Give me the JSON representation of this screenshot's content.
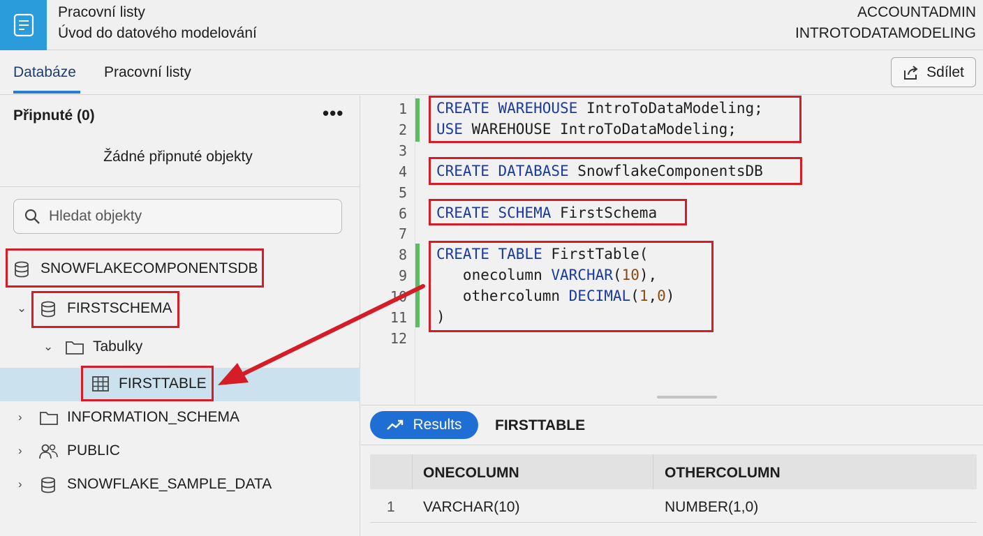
{
  "header": {
    "title_line1": "Pracovní listy",
    "title_line2": "Úvod do datového modelování",
    "role": "ACCOUNTADMIN",
    "warehouse": "INTROTODATAMODELING"
  },
  "tabs": [
    {
      "label": "Databáze",
      "active": true
    },
    {
      "label": "Pracovní listy",
      "active": false
    }
  ],
  "share_label": "Sdílet",
  "sidebar": {
    "pinned_header": "Připnuté (0)",
    "pinned_empty": "Žádné připnuté objekty",
    "search_placeholder": "Hledat objekty",
    "tree": [
      {
        "label": "SNOWFLAKECOMPONENTSDB",
        "icon": "database-icon",
        "level": 0,
        "highlighted": true
      },
      {
        "label": "FIRSTSCHEMA",
        "icon": "schema-icon",
        "level": 1,
        "expanded": true,
        "highlighted": true
      },
      {
        "label": "Tabulky",
        "icon": "folder-icon",
        "level": 2,
        "expanded": true
      },
      {
        "label": "FIRSTTABLE",
        "icon": "table-icon",
        "level": 3,
        "selected": true,
        "highlighted": true
      },
      {
        "label": "INFORMATION_SCHEMA",
        "icon": "folder-icon",
        "level": 1,
        "expanded": false
      },
      {
        "label": "PUBLIC",
        "icon": "users-icon",
        "level": 1,
        "expanded": false
      },
      {
        "label": "SNOWFLAKE_SAMPLE_DATA",
        "icon": "database-icon",
        "level": 1,
        "expanded": false
      }
    ]
  },
  "editor": {
    "line_numbers": [
      "1",
      "2",
      "3",
      "4",
      "5",
      "6",
      "7",
      "8",
      "9",
      "10",
      "11",
      "12"
    ],
    "lines": [
      "CREATE WAREHOUSE IntroToDataModeling;",
      "USE WAREHOUSE IntroToDataModeling;",
      "",
      "CREATE DATABASE SnowflakeComponentsDB",
      "",
      "CREATE SCHEMA FirstSchema",
      "",
      "CREATE TABLE FirstTable(",
      "   onecolumn VARCHAR(10),",
      "   othercolumn DECIMAL(1,0)",
      ")",
      ""
    ]
  },
  "results": {
    "button_label": "Results",
    "object_name": "FIRSTTABLE",
    "columns": [
      "ONECOLUMN",
      "OTHERCOLUMN"
    ],
    "rows": [
      {
        "index": "1",
        "values": [
          "VARCHAR(10)",
          "NUMBER(1,0)"
        ]
      }
    ]
  },
  "colors": {
    "logo_blue": "#2a9bdb",
    "highlight_red": "#d41d26",
    "selected_row": "#cbe1ee",
    "results_button": "#1f6ed4",
    "keyword": "#1a3a9c"
  }
}
